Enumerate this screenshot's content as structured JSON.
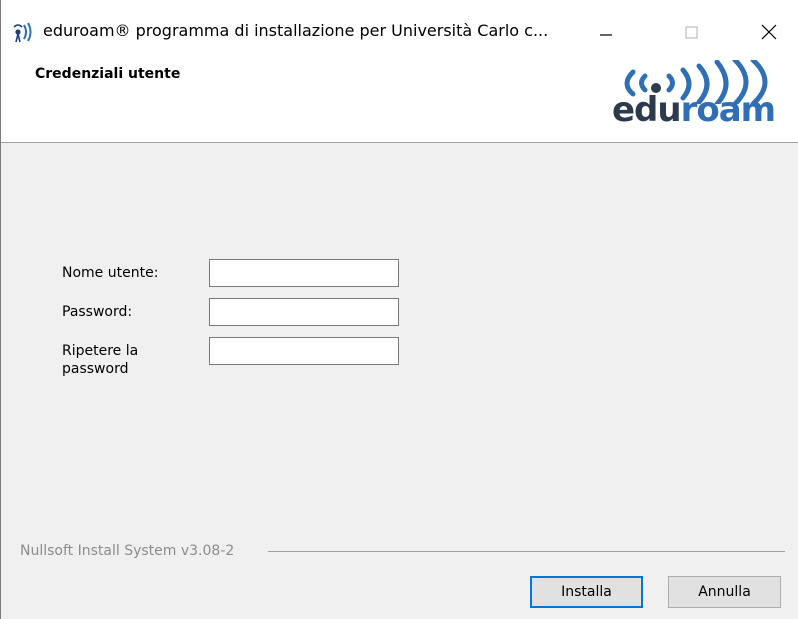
{
  "window": {
    "title": "eduroam® programma di installazione per Università Carlo c...",
    "minimize_icon": "minimize-icon",
    "maximize_icon": "maximize-icon",
    "close_icon": "close-icon"
  },
  "header": {
    "title": "Credenziali utente",
    "logo": {
      "edu": "edu",
      "roam": "roam"
    }
  },
  "form": {
    "username_label": "Nome utente:",
    "username_value": "",
    "password_label": "Password:",
    "password_value": "",
    "repeat_label_line1": "Ripetere la",
    "repeat_label_line2": "password",
    "repeat_value": ""
  },
  "footer": {
    "brand": "Nullsoft Install System v3.08-2",
    "install_label": "Installa",
    "cancel_label": "Annulla"
  },
  "colors": {
    "logo_dark": "#2b3a4c",
    "logo_blue": "#2f6fb5",
    "focus_blue": "#0078d7"
  }
}
